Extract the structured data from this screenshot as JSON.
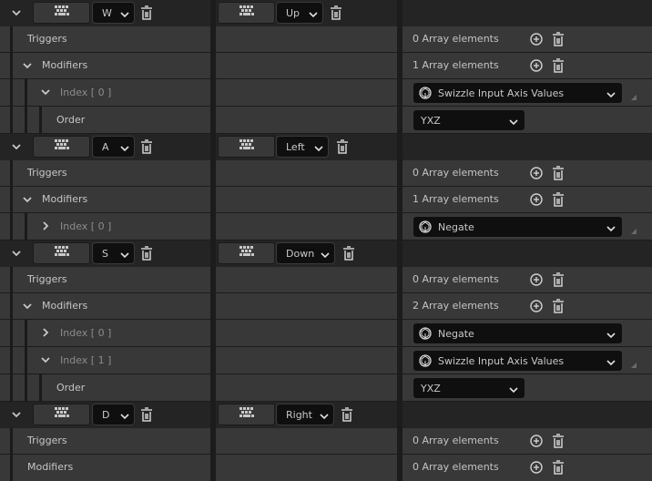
{
  "mappings": [
    {
      "key": "W",
      "action": "Up"
    },
    {
      "key": "A",
      "action": "Left"
    },
    {
      "key": "S",
      "action": "Down"
    },
    {
      "key": "D",
      "action": "Right"
    }
  ],
  "labels": {
    "triggers": "Triggers",
    "modifiers": "Modifiers",
    "index0": "Index [ 0 ]",
    "index1": "Index [ 1 ]",
    "order": "Order"
  },
  "counts": {
    "zero": "0 Array elements",
    "one": "1 Array elements",
    "two": "2 Array elements"
  },
  "modifiers": {
    "swizzle": "Swizzle Input Axis Values",
    "negate": "Negate"
  },
  "order_value": "YXZ",
  "colors": {
    "key_row": "#242424",
    "prop_row": "#383838",
    "input_bg": "#0f0f0f"
  }
}
